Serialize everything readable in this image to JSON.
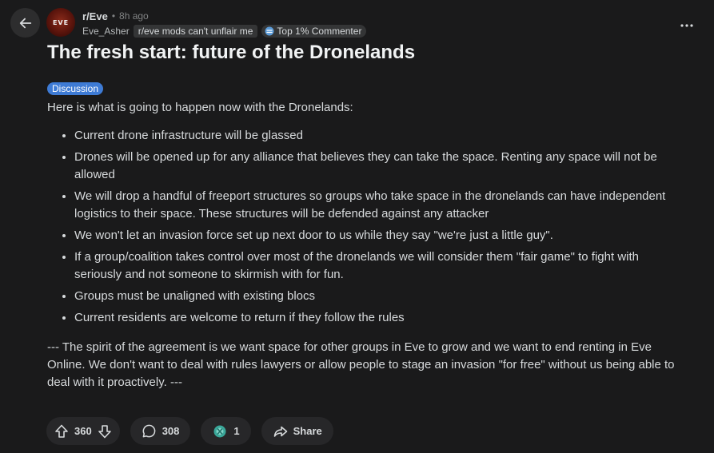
{
  "header": {
    "subreddit": "r/Eve",
    "separator": "•",
    "time_ago": "8h ago",
    "username": "Eve_Asher",
    "user_flair": "r/eve mods can't unflair me",
    "badge_label": "Top 1% Commenter",
    "avatar_text": "EVE"
  },
  "post": {
    "title": "The fresh start: future of the Dronelands",
    "flair": "Discussion",
    "intro": "Here is what is going to happen now with the Dronelands:",
    "bullets": [
      "Current drone infrastructure will be glassed",
      "Drones will be opened up for any alliance that believes they can take the space. Renting any space will not be allowed",
      "We will drop a handful of freeport structures so groups who take space in the dronelands can have independent logistics to their space. These structures will be defended against any attacker",
      "We won't let an invasion force set up next door to us while they say \"we're just a little guy\".",
      "If a group/coalition takes control over most of the dronelands we will consider them \"fair game\" to fight with seriously and not someone to skirmish with for fun.",
      "Groups must be unaligned with existing blocs",
      "Current residents are welcome to return if they follow the rules"
    ],
    "outro": "--- The spirit of the agreement is we want space for other groups in Eve to grow and we want to end renting in Eve Online. We don't want to deal with rules lawyers or allow people to stage an invasion \"for free\" without us being able to deal with it proactively. ---"
  },
  "actions": {
    "votes": "360",
    "comments": "308",
    "awards": "1",
    "share_label": "Share"
  },
  "colors": {
    "background": "#1a1a1b",
    "flair_blue": "#3e7bd5",
    "pill_bg": "#272729"
  }
}
